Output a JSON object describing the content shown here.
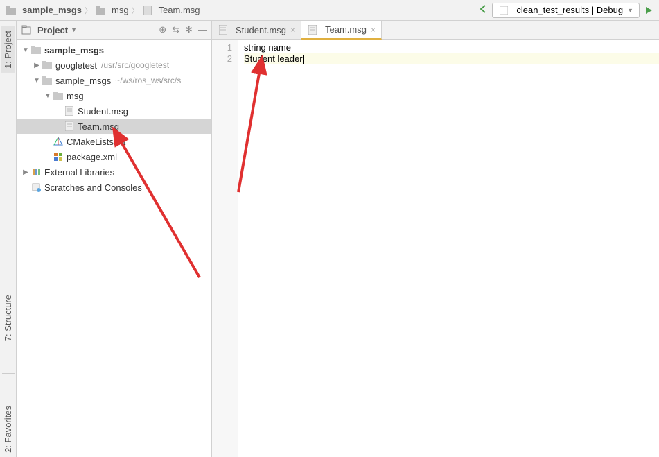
{
  "breadcrumb": {
    "items": [
      {
        "label": "sample_msgs",
        "icon": "folder"
      },
      {
        "label": "msg",
        "icon": "folder"
      },
      {
        "label": "Team.msg",
        "icon": "file"
      }
    ]
  },
  "run_config": {
    "label": "clean_test_results | Debug"
  },
  "left_tabs": {
    "project": "1: Project",
    "structure": "7: Structure",
    "favorites": "2: Favorites"
  },
  "project_panel": {
    "title": "Project",
    "tree": [
      {
        "depth": 0,
        "arrow": "down",
        "icon": "folder",
        "label": "sample_msgs",
        "bold": true,
        "hint": ""
      },
      {
        "depth": 1,
        "arrow": "right",
        "icon": "folder",
        "label": "googletest",
        "hint": "/usr/src/googletest"
      },
      {
        "depth": 1,
        "arrow": "down",
        "icon": "folder",
        "label": "sample_msgs",
        "hint": "~/ws/ros_ws/src/s"
      },
      {
        "depth": 2,
        "arrow": "down",
        "icon": "folder",
        "label": "msg",
        "hint": ""
      },
      {
        "depth": 3,
        "arrow": "",
        "icon": "file",
        "label": "Student.msg",
        "hint": ""
      },
      {
        "depth": 3,
        "arrow": "",
        "icon": "file",
        "label": "Team.msg",
        "hint": "",
        "selected": true
      },
      {
        "depth": 2,
        "arrow": "",
        "icon": "cmake",
        "label": "CMakeLists.txt",
        "hint": ""
      },
      {
        "depth": 2,
        "arrow": "",
        "icon": "xml",
        "label": "package.xml",
        "hint": ""
      },
      {
        "depth": 0,
        "arrow": "right",
        "icon": "lib",
        "label": "External Libraries",
        "hint": ""
      },
      {
        "depth": 0,
        "arrow": "",
        "icon": "scratch",
        "label": "Scratches and Consoles",
        "hint": ""
      }
    ]
  },
  "editor": {
    "tabs": [
      {
        "label": "Student.msg",
        "active": false
      },
      {
        "label": "Team.msg",
        "active": true
      }
    ],
    "lines": [
      {
        "n": "1",
        "text": "string name",
        "current": false
      },
      {
        "n": "2",
        "text": "Student leader",
        "current": true
      }
    ]
  }
}
